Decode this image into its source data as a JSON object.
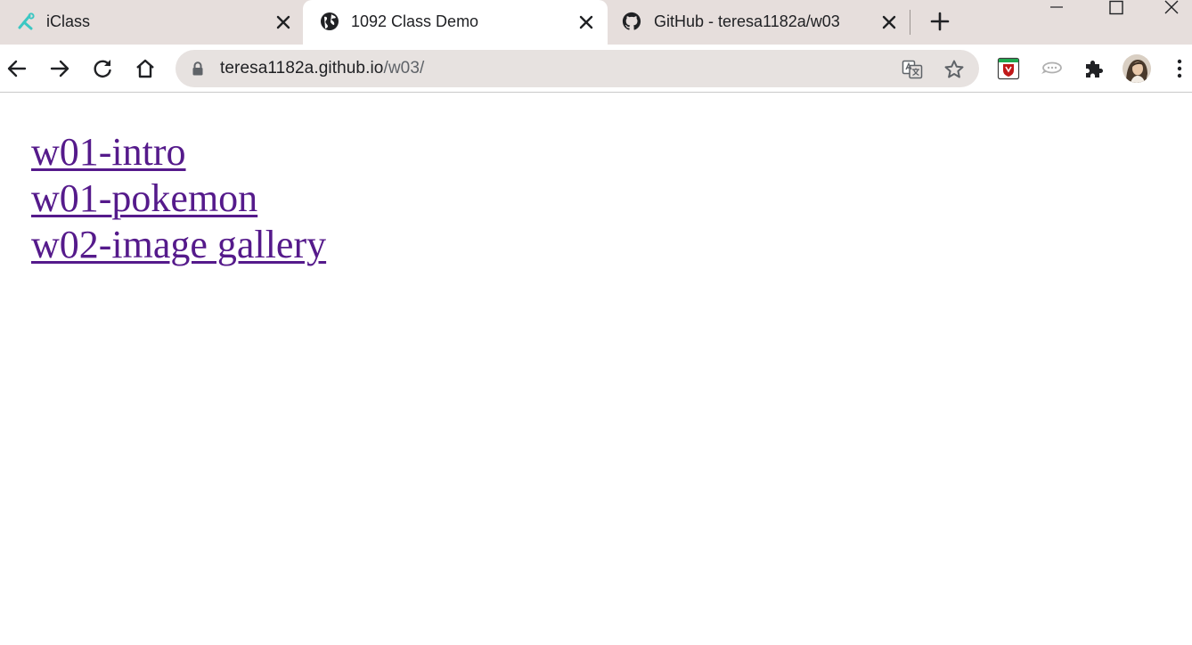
{
  "browser": {
    "tabs": [
      {
        "title": "iClass",
        "favicon": "iclass-logo-icon",
        "active": false
      },
      {
        "title": "1092 Class Demo",
        "favicon": "globe-icon",
        "active": true
      },
      {
        "title": "GitHub - teresa1182a/w03",
        "favicon": "github-icon",
        "active": false
      }
    ],
    "address": {
      "host": "teresa1182a.github.io",
      "path": "/w03/"
    },
    "colors": {
      "tabstrip": "#e6dedc",
      "active_tab": "#ffffff",
      "omnibox": "#e7e2e0",
      "visited_link": "#551a8b"
    }
  },
  "page": {
    "links": [
      {
        "label": "w01-intro"
      },
      {
        "label": "w01-pokemon"
      },
      {
        "label": "w02-image gallery"
      }
    ]
  }
}
